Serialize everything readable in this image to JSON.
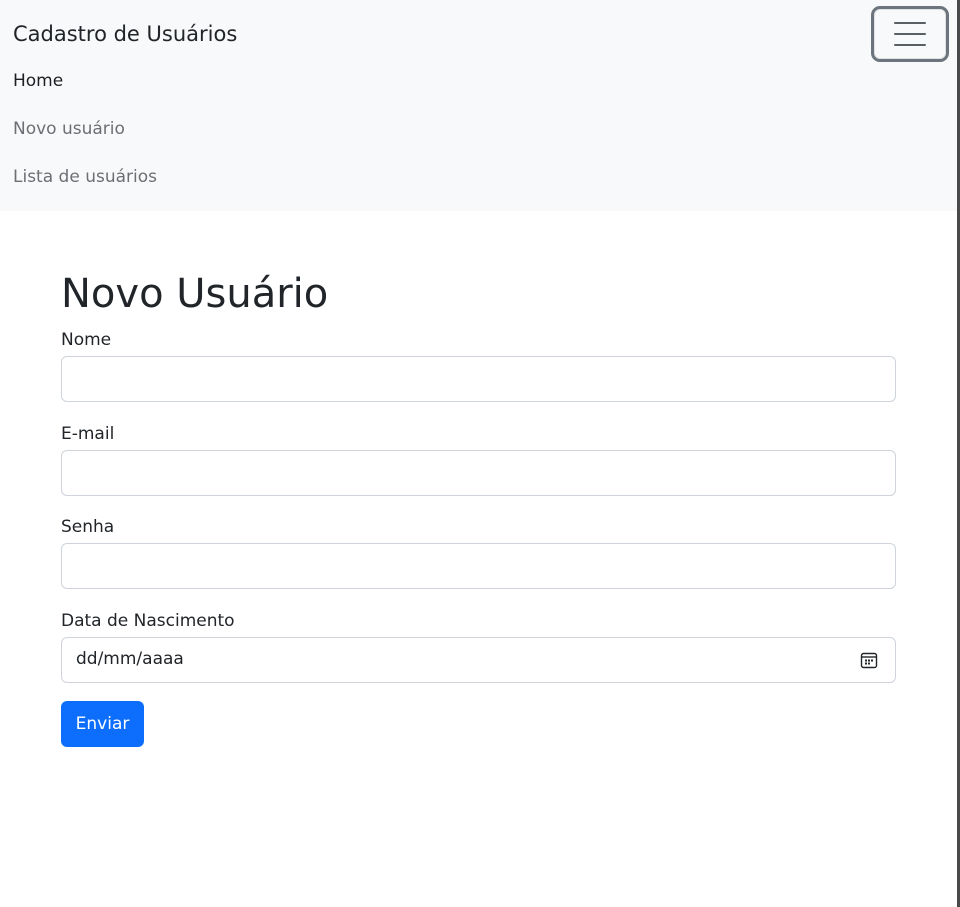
{
  "navbar": {
    "brand": "Cadastro de Usuários",
    "toggler_icon": "hamburger-icon",
    "links": [
      {
        "label": "Home",
        "active": true
      },
      {
        "label": "Novo usuário",
        "active": false
      },
      {
        "label": "Lista de usuários",
        "active": false
      }
    ]
  },
  "form": {
    "title": "Novo Usuário",
    "fields": {
      "nome": {
        "label": "Nome",
        "value": ""
      },
      "email": {
        "label": "E-mail",
        "value": ""
      },
      "senha": {
        "label": "Senha",
        "value": ""
      },
      "nascimento": {
        "label": "Data de Nascimento",
        "placeholder": "dd/mm/aaaa",
        "icon": "calendar-icon"
      }
    },
    "submit_label": "Enviar"
  },
  "colors": {
    "navbar_bg": "#f8f9fa",
    "primary": "#0d6efd",
    "text": "#212529",
    "muted": "#6c757d"
  }
}
